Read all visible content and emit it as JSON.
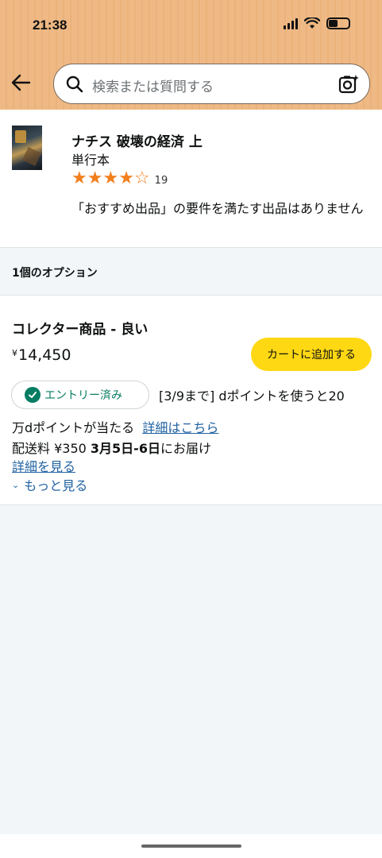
{
  "status_bar": {
    "time": "21:38"
  },
  "search": {
    "placeholder": "検索または質問する"
  },
  "product": {
    "title": "ナチス 破壊の経済 上",
    "format": "単行本",
    "rating": 4,
    "rating_max": 5,
    "review_count": "19",
    "no_featured_offer": "「おすすめ出品」の要件を満たす出品はありません"
  },
  "options": {
    "header": "1個のオプション"
  },
  "offer": {
    "condition": "コレクター商品 - 良い",
    "currency": "¥",
    "price": "14,450",
    "add_to_cart": "カートに追加する",
    "entry_badge": "エントリー済み",
    "promo_part1": "[3/9まで] dポイントを使うと20",
    "promo_part2": "万dポイントが当たる",
    "promo_link": "詳細はこちら",
    "shipping_prefix": "配送料 ¥350 ",
    "delivery_dates": "3月5日-6日",
    "delivery_suffix": "にお届け",
    "details_link": "詳細を見る",
    "more_link": "もっと見る"
  },
  "colors": {
    "header_bg": "#efb985",
    "cart_button": "#ffd814",
    "star": "#f27f1c",
    "link": "#2162a1",
    "badge_green": "#067d62"
  }
}
